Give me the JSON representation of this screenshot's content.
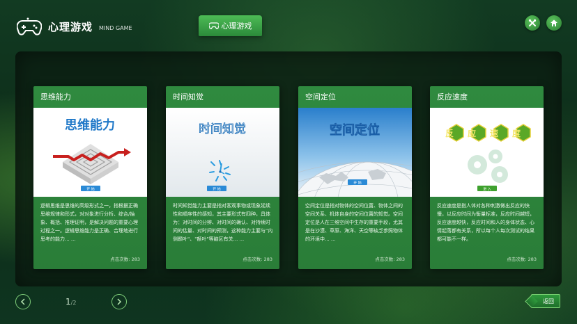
{
  "app": {
    "title": "心理游戏",
    "subtitle": "MIND GAME",
    "top_tab_label": "心理游戏",
    "header_icons": [
      "tools-icon",
      "home-icon"
    ]
  },
  "cards": [
    {
      "title": "思维能力",
      "banner_text": "思维能力",
      "button_label": "开 始",
      "description": "逻辑思维是思维的高级形式之一，指根据正确思维规律和形式，对对象进行分析、综合/抽象、概括、推理证明，是解决问题的重要心理过程之一。逻辑思维能力是正确、合理地进行思考的能力... ...",
      "count_label": "点击次数:",
      "count_value": "283"
    },
    {
      "title": "时间知觉",
      "banner_text": "时间知觉",
      "button_label": "开 始",
      "description": "时间知觉能力主要是指对客观事物或现象延续性和顺序性的感知，其主要形式有四种，具体为：对时间的分辨、对时间的确认、对持续时间的估量、对时间的预测，这种能力主要与\"内侧颞叶\"、\"额叶\"等脑区有关... ...",
      "count_label": "点击次数:",
      "count_value": "283"
    },
    {
      "title": "空间定位",
      "banner_text": "空间定位",
      "button_label": "开 始",
      "description": "空间定位是指对物体的空间位置、物体之间的空间关系、机体自身的空间位置的知觉。空间定位是人在三维空间中生存的重要手段，尤其是在沙漠、草原、海洋、天空等缺乏参照物体的环境中... ...",
      "count_label": "点击次数:",
      "count_value": "283"
    },
    {
      "title": "反应速度",
      "banner_text": "反应速度",
      "button_label": "进 入",
      "description": "反应速度是指人体对各种刺激做出反应的快慢，以反应时间为衡量标准，反应时间越短，反应速度越快，反应时间和人的身体状态、心情起落都有关系，所以每个人每次测试的结果都可能不一样。",
      "count_label": "点击次数:",
      "count_value": "283"
    }
  ],
  "pager": {
    "current": "1",
    "separator": "/",
    "total": "2"
  },
  "back_label": "返回",
  "colors": {
    "accent": "#2f8a3f",
    "banner_blue": "#1a6fc4",
    "maze_red": "#c8201e"
  }
}
